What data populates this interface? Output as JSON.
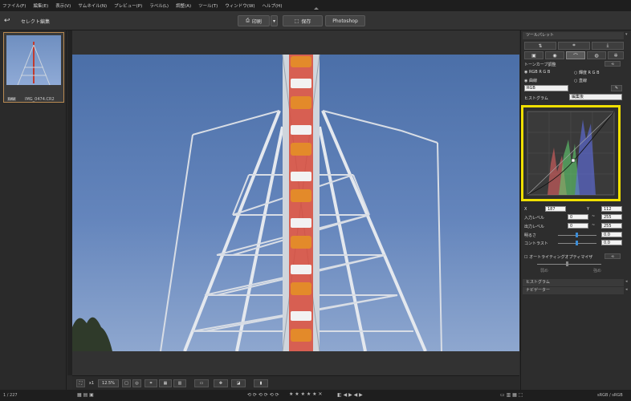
{
  "menu": [
    "ファイル(F)",
    "編集(E)",
    "表示(V)",
    "サムネイル(N)",
    "プレビュー(P)",
    "ラベル(L)",
    "調整(A)",
    "ツール(T)",
    "ウィンドウ(W)",
    "ヘルプ(H)"
  ],
  "toolbar": {
    "back_icon": "undo-arrow-icon",
    "title": "セレクト編集",
    "print_label": "印刷",
    "save_label": "保存",
    "photoshop_label": "Photoshop"
  },
  "filmstrip": {
    "filename": "IMG_0474.CR2",
    "tag": "RAW"
  },
  "bottombar": {
    "zoom_one": "x1",
    "zoom_value": "12.5%"
  },
  "status": {
    "count": "1 / 227",
    "color_space": "sRGB / sRGB"
  },
  "panel": {
    "title": "ツールパレット",
    "tone_curve_title": "トーンカーブ調整",
    "rgb_mode_1": "RGB R G B",
    "rgb_mode_2": "輝度 R G B",
    "curve_type_1": "曲線",
    "curve_type_2": "直線",
    "channel": "RGB",
    "histogram_label": "ヒストグラム",
    "histogram_mode": "編集後",
    "x_label": "X",
    "x_value": "187",
    "y_label": "Y",
    "y_value": "112",
    "input_level_label": "入力レベル",
    "input_low": "0",
    "input_high": "255",
    "output_level_label": "出力レベル",
    "output_low": "0",
    "output_high": "255",
    "brightness_label": "明るさ",
    "brightness_value": "0.0",
    "contrast_label": "コントラスト",
    "contrast_value": "0.0",
    "alo_label": "オートライティングオプティマイザ",
    "alo_low": "弱め",
    "alo_high": "強め",
    "histogram_section": "ヒストグラム",
    "navigator_section": "ナビゲーター"
  },
  "colors": {
    "highlight": "#f0e000",
    "accent": "#3b8dd8",
    "thumb_border": "#b88a53"
  }
}
